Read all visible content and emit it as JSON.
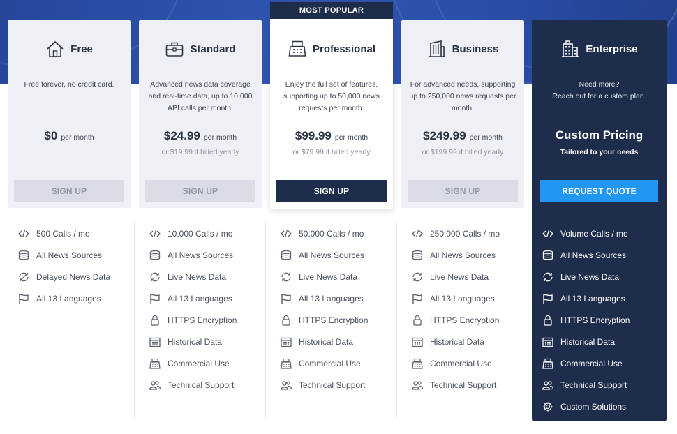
{
  "plans": [
    {
      "name": "Free",
      "icon": "house-icon",
      "description": "Free forever, no credit card.",
      "price": "$0",
      "per": "per month",
      "yearly": "",
      "button": "SIGN UP",
      "features": [
        {
          "icon": "code-icon",
          "label": "500 Calls / mo"
        },
        {
          "icon": "database-icon",
          "label": "All News Sources"
        },
        {
          "icon": "delayed-sync-icon",
          "label": "Delayed News Data"
        },
        {
          "icon": "flag-icon",
          "label": "All 13 Languages"
        }
      ]
    },
    {
      "name": "Standard",
      "icon": "briefcase-icon",
      "description": "Advanced news data coverage and real-time data, up to 10,000 API calls per month.",
      "price": "$24.99",
      "per": "per month",
      "yearly": "or $19.99 if billed yearly",
      "button": "SIGN UP",
      "features": [
        {
          "icon": "code-icon",
          "label": "10,000 Calls / mo"
        },
        {
          "icon": "database-icon",
          "label": "All News Sources"
        },
        {
          "icon": "refresh-icon",
          "label": "Live News Data"
        },
        {
          "icon": "flag-icon",
          "label": "All 13 Languages"
        },
        {
          "icon": "lock-icon",
          "label": "HTTPS Encryption"
        },
        {
          "icon": "calendar-icon",
          "label": "Historical Data"
        },
        {
          "icon": "cash-register-icon",
          "label": "Commercial Use"
        },
        {
          "icon": "users-icon",
          "label": "Technical Support"
        }
      ]
    },
    {
      "name": "Professional",
      "icon": "cash-register-icon",
      "badge": "MOST POPULAR",
      "description": "Enjoy the full set of features, supporting up to 50,000 news requests per month.",
      "price": "$99.99",
      "per": "per month",
      "yearly": "or $79.99 if billed yearly",
      "button": "SIGN UP",
      "features": [
        {
          "icon": "code-icon",
          "label": "50,000 Calls / mo"
        },
        {
          "icon": "database-icon",
          "label": "All News Sources"
        },
        {
          "icon": "refresh-icon",
          "label": "Live News Data"
        },
        {
          "icon": "flag-icon",
          "label": "All 13 Languages"
        },
        {
          "icon": "lock-icon",
          "label": "HTTPS Encryption"
        },
        {
          "icon": "calendar-icon",
          "label": "Historical Data"
        },
        {
          "icon": "cash-register-icon",
          "label": "Commercial Use"
        },
        {
          "icon": "users-icon",
          "label": "Technical Support"
        }
      ]
    },
    {
      "name": "Business",
      "icon": "building-icon",
      "description": "For advanced needs, supporting up to 250,000 news requests per month.",
      "price": "$249.99",
      "per": "per month",
      "yearly": "or $199.99 if billed yearly",
      "button": "SIGN UP",
      "features": [
        {
          "icon": "code-icon",
          "label": "250,000 Calls / mo"
        },
        {
          "icon": "database-icon",
          "label": "All News Sources"
        },
        {
          "icon": "refresh-icon",
          "label": "Live News Data"
        },
        {
          "icon": "flag-icon",
          "label": "All 13 Languages"
        },
        {
          "icon": "lock-icon",
          "label": "HTTPS Encryption"
        },
        {
          "icon": "calendar-icon",
          "label": "Historical Data"
        },
        {
          "icon": "cash-register-icon",
          "label": "Commercial Use"
        },
        {
          "icon": "users-icon",
          "label": "Technical Support"
        }
      ]
    }
  ],
  "enterprise": {
    "name": "Enterprise",
    "icon": "skyscraper-icon",
    "description_line1": "Need more?",
    "description_line2": "Reach out for a custom plan.",
    "price_title": "Custom Pricing",
    "price_sub": "Tailored to your needs",
    "button": "REQUEST QUOTE",
    "features": [
      {
        "icon": "code-icon",
        "label": "Volume Calls / mo"
      },
      {
        "icon": "database-icon",
        "label": "All News Sources"
      },
      {
        "icon": "refresh-icon",
        "label": "Live News Data"
      },
      {
        "icon": "flag-icon",
        "label": "All 13 Languages"
      },
      {
        "icon": "lock-icon",
        "label": "HTTPS Encryption"
      },
      {
        "icon": "calendar-icon",
        "label": "Historical Data"
      },
      {
        "icon": "cash-register-icon",
        "label": "Commercial Use"
      },
      {
        "icon": "users-icon",
        "label": "Technical Support"
      },
      {
        "icon": "gear-icon",
        "label": "Custom Solutions"
      }
    ]
  },
  "colors": {
    "band": "#2a4fa9",
    "navy": "#1f2d4d",
    "accent": "#2196f3",
    "card": "#eef0f6",
    "disabled_button": "#d9dce4"
  }
}
